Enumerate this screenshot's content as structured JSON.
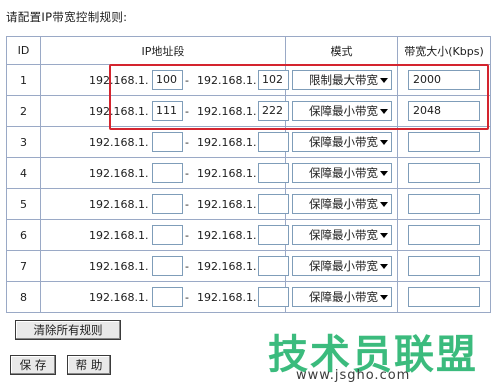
{
  "title": "请配置IP带宽控制规则:",
  "headers": {
    "id": "ID",
    "ip_range": "IP地址段",
    "mode": "模式",
    "bandwidth": "带宽大小(Kbps)"
  },
  "ip_prefix": "192.168.1.",
  "dash": "-",
  "rows": [
    {
      "id": "1",
      "start": "100",
      "end": "102",
      "mode": "限制最大带宽",
      "bandwidth": "2000"
    },
    {
      "id": "2",
      "start": "111",
      "end": "222",
      "mode": "保障最小带宽",
      "bandwidth": "2048"
    },
    {
      "id": "3",
      "start": "",
      "end": "",
      "mode": "保障最小带宽",
      "bandwidth": ""
    },
    {
      "id": "4",
      "start": "",
      "end": "",
      "mode": "保障最小带宽",
      "bandwidth": ""
    },
    {
      "id": "5",
      "start": "",
      "end": "",
      "mode": "保障最小带宽",
      "bandwidth": ""
    },
    {
      "id": "6",
      "start": "",
      "end": "",
      "mode": "保障最小带宽",
      "bandwidth": ""
    },
    {
      "id": "7",
      "start": "",
      "end": "",
      "mode": "保障最小带宽",
      "bandwidth": ""
    },
    {
      "id": "8",
      "start": "",
      "end": "",
      "mode": "保障最小带宽",
      "bandwidth": ""
    }
  ],
  "buttons": {
    "clear_all": "清除所有规则",
    "save": "保 存",
    "help": "帮 助"
  },
  "watermark": {
    "brand": "技术员联盟",
    "url": "www.jsgho.com"
  },
  "colors": {
    "highlight": "#d4242e",
    "grid": "#9aa9c6",
    "watermark": "#2bb673"
  }
}
